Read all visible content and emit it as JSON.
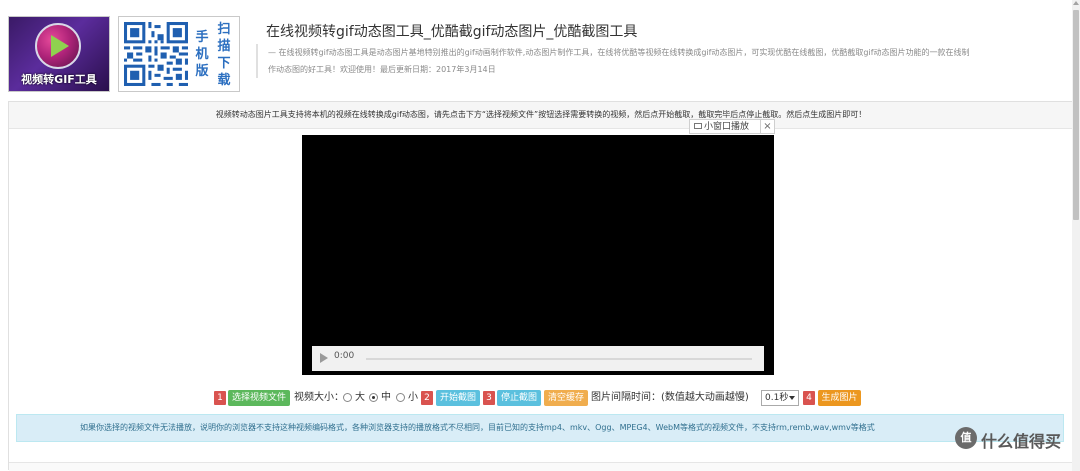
{
  "header": {
    "logo_text": "视频转GIF工具",
    "qr_labels": [
      "手",
      "机",
      "版",
      "扫",
      "描",
      "下",
      "载"
    ],
    "title": "在线视频转gif动态图工具_优酷截gif动态图片_优酷截图工具",
    "description_line1": "— 在线视频转gif动态图工具是动态图片基地特别推出的gif动画制作软件,动态图片制作工具，在线将优酷等视频在线转换成gif动态图片，可实现优酷在线截图，优酷截取gif动态图片功能的一款在线制",
    "description_line2": "作动态图的好工具！欢迎使用！最后更新日期：2017年3月14日"
  },
  "notice": "视频转动态图片工具支持将本机的视频在线转换成gif动态图，请先点击下方“选择视频文件”按钮选择需要转换的视频，然后点开始截取，截取完毕后点停止截取。然后点生成图片即可！",
  "video": {
    "time": "0:00",
    "mini_window_label": "小窗口播放",
    "close_label": "×"
  },
  "controls": {
    "step1": "1",
    "select_file": "选择视频文件",
    "size_label": "视频大小：",
    "size_large": "大",
    "size_medium": "中",
    "size_small": "小",
    "step2": "2",
    "start_capture": "开始截图",
    "step3": "3",
    "stop_capture": "停止截图",
    "clear_cache": "清空缓存",
    "interval_label": "图片间隔时间：(数值越大动画越慢)",
    "interval_value": "0.1秒",
    "step4": "4",
    "generate": "生成图片",
    "selected_size": "中"
  },
  "info": "如果你选择的视频文件无法播放，说明你的浏览器不支持这种视频编码格式，各种浏览器支持的播放格式不尽相同，目前已知的支持mp4、mkv、Ogg、MPEG4、WebM等格式的视频文件，不支持rm,remb,wav,wmv等格式",
  "watermark": {
    "badge": "值",
    "text": "什么值得买"
  },
  "colors": {
    "step_badge": "#d9534f",
    "green_button": "#5cb85c",
    "blue_button": "#5bc0de",
    "orange_button": "#f0ad4e",
    "info_bg": "#d9edf7"
  }
}
